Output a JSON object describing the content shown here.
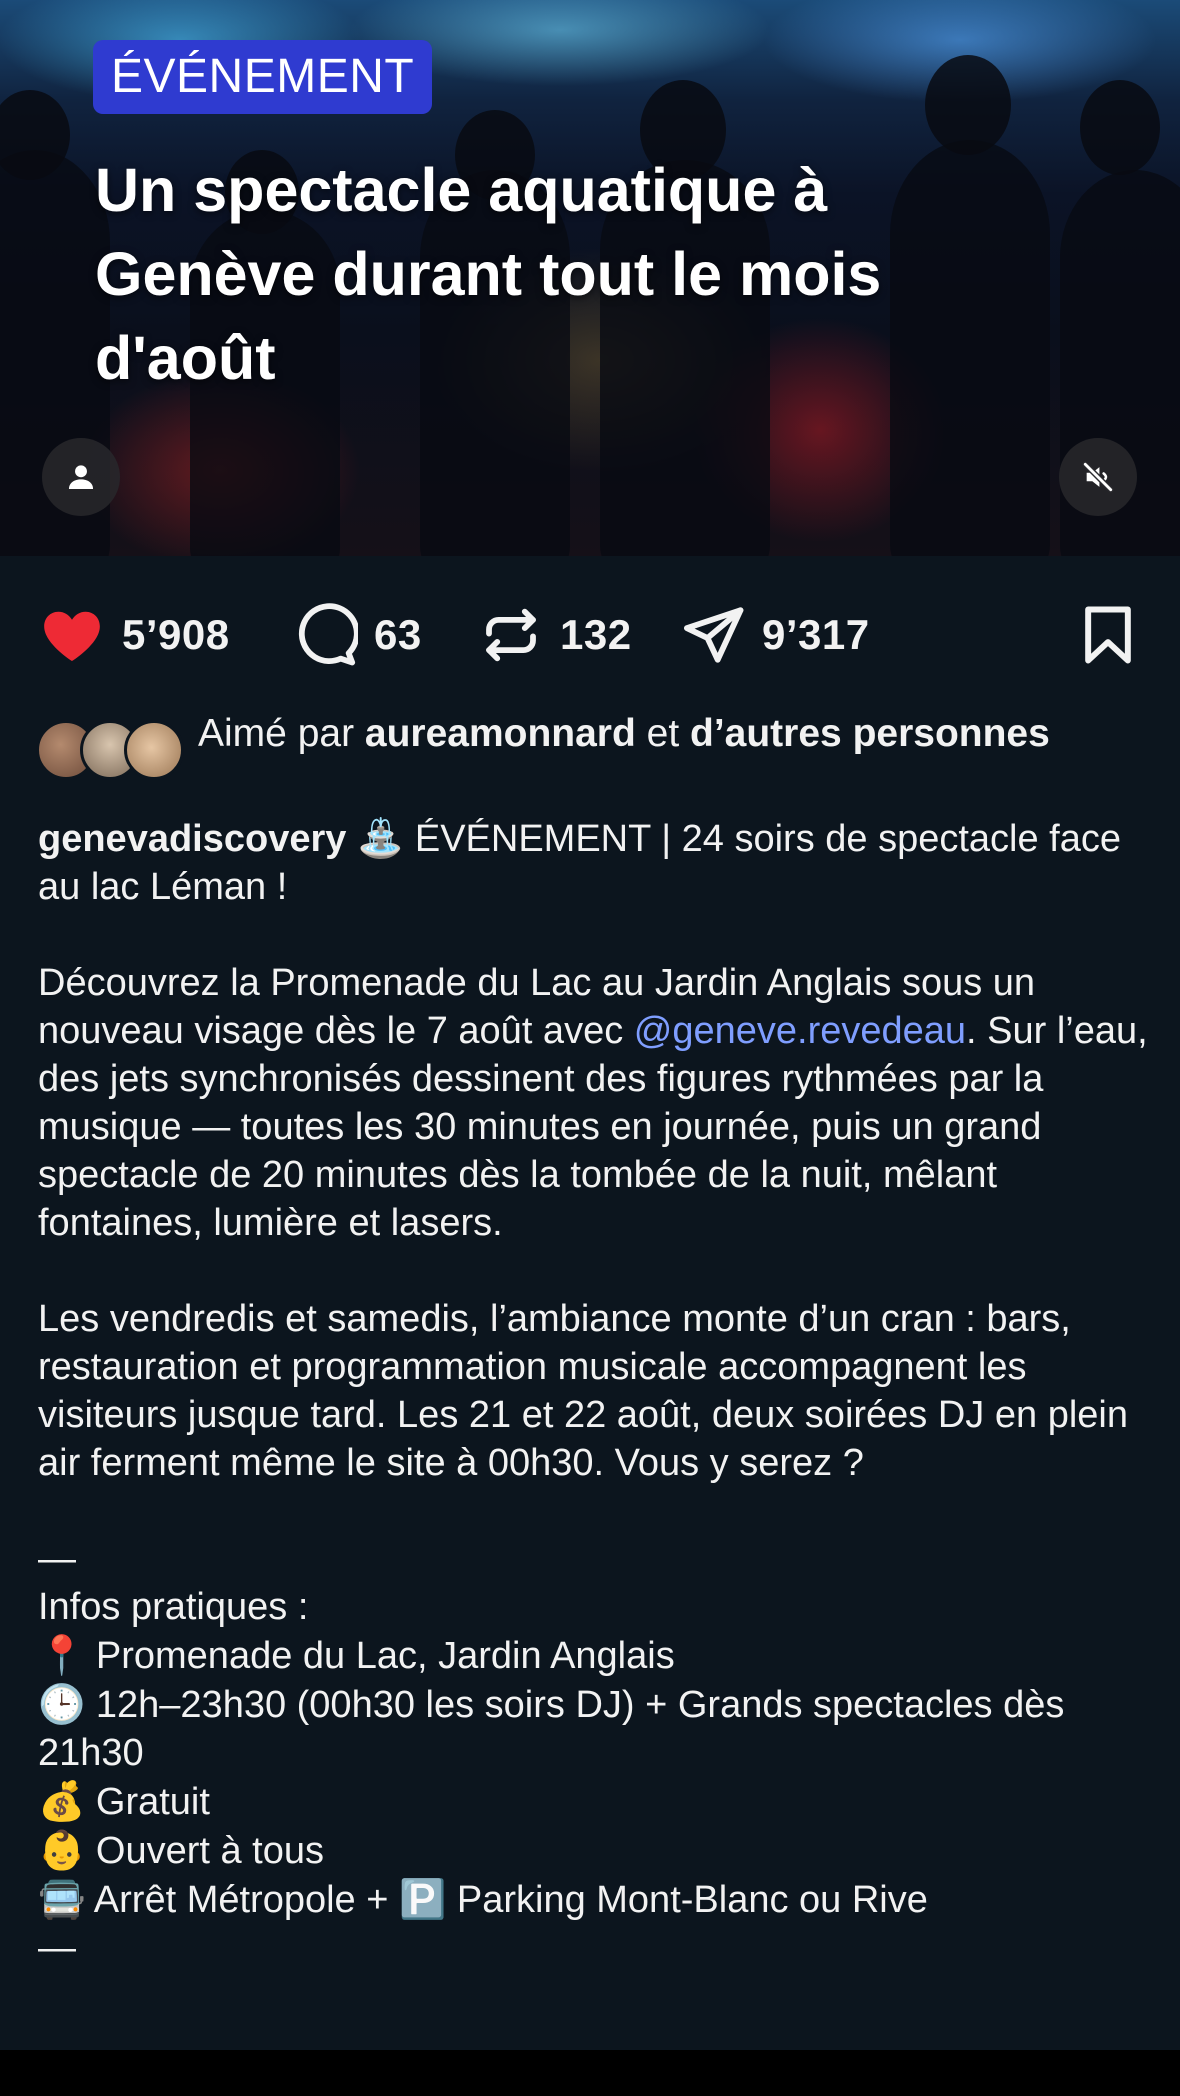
{
  "hero": {
    "badge": "ÉVÉNEMENT",
    "title": "Un spectacle aquatique à Genève durant tout le mois d'août",
    "profile_icon": "person-icon",
    "mute_icon": "speaker-muted-icon"
  },
  "actions": {
    "like_count": "5’908",
    "comment_count": "63",
    "repost_count": "132",
    "share_count": "9’317",
    "like_color": "#ee2a35"
  },
  "liked_by": {
    "prefix": "Aimé par ",
    "user": "aureamonnard",
    "middle": " et ",
    "others": "d’autres personnes"
  },
  "post": {
    "username": "genevadiscovery",
    "emoji_fountain": "⛲",
    "headline": " ÉVÉNEMENT | 24 soirs de spectacle face au lac Léman !",
    "para1_a": "Découvrez la Promenade du Lac au Jardin Anglais sous un nouveau visage dès le 7 août avec ",
    "mention": "@geneve.revedeau",
    "para1_b": ". Sur l’eau, des jets synchronisés dessinent des figures rythmées par la musique — toutes les 30 minutes en journée, puis un grand spectacle de 20 minutes dès la tombée de la nuit, mêlant fontaines, lumière et lasers.",
    "para2": "Les vendredis et samedis, l’ambiance monte d’un cran : bars, restauration et programmation musicale accompagnent les visiteurs jusque tard. Les 21 et 22 août, deux soirées DJ en plein air ferment même le site à 00h30. Vous y serez ?",
    "divider1": "—",
    "infos_title": "Infos pratiques :",
    "info_location_emoji": "📍",
    "info_location": " Promenade du Lac, Jardin Anglais",
    "info_time_emoji": "🕒",
    "info_time": " 12h–23h30 (00h30 les soirs DJ) + Grands spectacles dès 21h30",
    "info_price_emoji": "💰",
    "info_price": " Gratuit",
    "info_audience_emoji": "👶",
    "info_audience": " Ouvert à tous",
    "info_transport_emoji": "🚍",
    "info_transport_a": " Arrêt Métropole + ",
    "info_parking_emoji": "🅿️",
    "info_transport_b": " Parking Mont-Blanc ou Rive",
    "divider2": "—"
  }
}
